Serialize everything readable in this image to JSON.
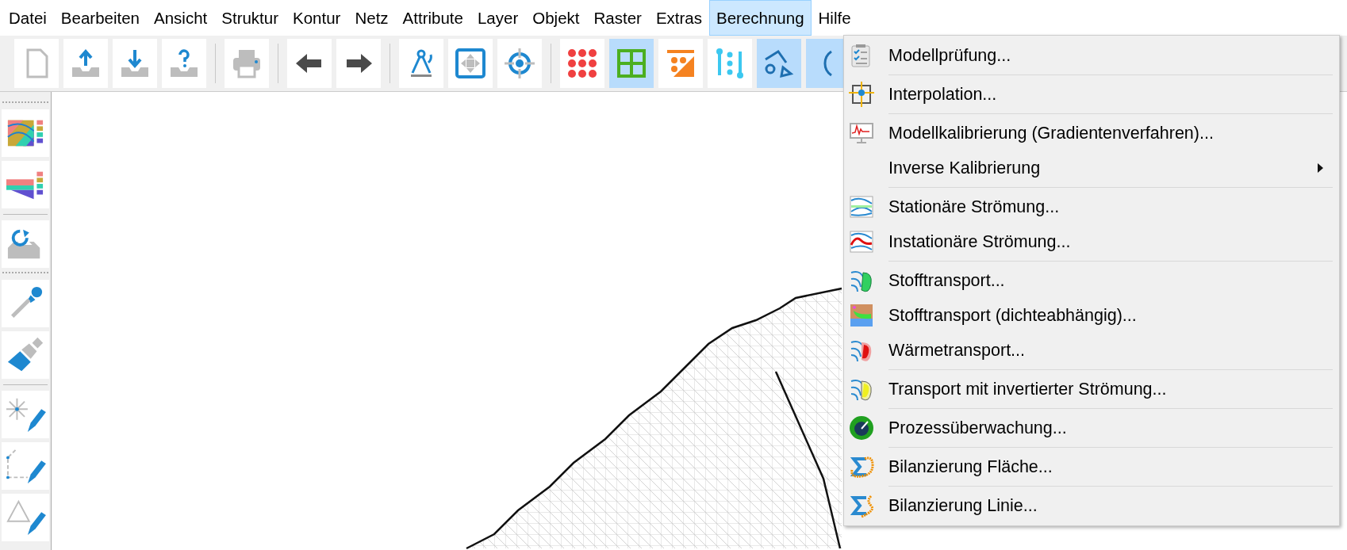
{
  "menu_bar": [
    {
      "label": "Datei",
      "selected": false
    },
    {
      "label": "Bearbeiten",
      "selected": false
    },
    {
      "label": "Ansicht",
      "selected": false
    },
    {
      "label": "Struktur",
      "selected": false
    },
    {
      "label": "Kontur",
      "selected": false
    },
    {
      "label": "Netz",
      "selected": false
    },
    {
      "label": "Attribute",
      "selected": false
    },
    {
      "label": "Layer",
      "selected": false
    },
    {
      "label": "Objekt",
      "selected": false
    },
    {
      "label": "Raster",
      "selected": false
    },
    {
      "label": "Extras",
      "selected": false
    },
    {
      "label": "Berechnung",
      "selected": true
    },
    {
      "label": "Hilfe",
      "selected": false
    }
  ],
  "toolbar": [
    {
      "buttons": [
        {
          "kind": "new-document",
          "active": false
        },
        {
          "kind": "upload",
          "active": false
        },
        {
          "kind": "download",
          "active": false
        },
        {
          "kind": "help-upload",
          "active": false
        }
      ]
    },
    {
      "buttons": [
        {
          "kind": "printer",
          "active": false
        }
      ]
    },
    {
      "buttons": [
        {
          "kind": "arrow-left",
          "active": false
        },
        {
          "kind": "arrow-right",
          "active": false
        }
      ]
    },
    {
      "buttons": [
        {
          "kind": "compass",
          "active": false
        },
        {
          "kind": "fit-view",
          "active": false
        },
        {
          "kind": "target",
          "active": false
        }
      ]
    },
    {
      "buttons": [
        {
          "kind": "dots",
          "active": false
        },
        {
          "kind": "grid",
          "active": true
        },
        {
          "kind": "corner-dots",
          "active": false
        },
        {
          "kind": "line-dots",
          "active": false
        },
        {
          "kind": "shapes",
          "active": true
        },
        {
          "kind": "partial",
          "active": true
        }
      ]
    }
  ],
  "sidebar": [
    {
      "buttons": [
        {
          "kind": "layer-map"
        },
        {
          "kind": "cross-section"
        }
      ]
    },
    {
      "buttons": [
        {
          "kind": "reload-tray"
        }
      ]
    },
    {
      "buttons": [
        {
          "kind": "pipette"
        },
        {
          "kind": "brush"
        }
      ]
    },
    {
      "buttons": [
        {
          "kind": "point-pencil"
        },
        {
          "kind": "polyline-pencil"
        },
        {
          "kind": "triangle-pencil"
        }
      ]
    }
  ],
  "dropdown": [
    {
      "items": [
        {
          "kind": "checklist",
          "label": "Modellprüfung...",
          "submenu": false
        }
      ]
    },
    {
      "items": [
        {
          "kind": "interpolation",
          "label": "Interpolation...",
          "submenu": false
        }
      ]
    },
    {
      "items": [
        {
          "kind": "calibration",
          "label": "Modellkalibrierung (Gradientenverfahren)...",
          "submenu": false
        },
        {
          "kind": "none",
          "label": "Inverse Kalibrierung",
          "submenu": true
        }
      ]
    },
    {
      "items": [
        {
          "kind": "steady-flow",
          "label": "Stationäre Strömung...",
          "submenu": false
        },
        {
          "kind": "transient-flow",
          "label": "Instationäre Strömung...",
          "submenu": false
        }
      ]
    },
    {
      "items": [
        {
          "kind": "mass-transport",
          "label": "Stofftransport...",
          "submenu": false
        },
        {
          "kind": "density-transport",
          "label": "Stofftransport (dichteabhängig)...",
          "submenu": false
        },
        {
          "kind": "heat-transport",
          "label": "Wärmetransport...",
          "submenu": false
        }
      ]
    },
    {
      "items": [
        {
          "kind": "inverted-transport",
          "label": "Transport mit invertierter Strömung...",
          "submenu": false
        }
      ]
    },
    {
      "items": [
        {
          "kind": "monitor",
          "label": "Prozessüberwachung...",
          "submenu": false
        }
      ]
    },
    {
      "items": [
        {
          "kind": "balance-area",
          "label": "Bilanzierung Fläche...",
          "submenu": false
        }
      ]
    },
    {
      "items": [
        {
          "kind": "balance-line",
          "label": "Bilanzierung Linie...",
          "submenu": false
        }
      ]
    }
  ]
}
